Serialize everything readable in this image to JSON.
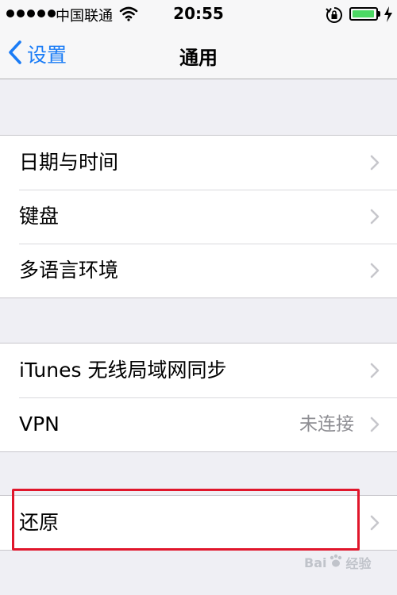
{
  "status_bar": {
    "carrier": "中国联通",
    "time": "20:55",
    "signal_icon": "signal-dots-icon",
    "wifi_icon": "wifi-icon",
    "lock_icon": "rotation-lock-icon",
    "battery_icon": "battery-icon",
    "battery_level": 0.95,
    "charging_icon": "charging-bolt-icon",
    "battery_color": "#4cd964"
  },
  "nav": {
    "back_label": "设置",
    "back_icon": "chevron-left-icon",
    "title": "通用",
    "accent_color": "#1a7cf6"
  },
  "groups": [
    {
      "rows": [
        {
          "label": "日期与时间",
          "detail": ""
        },
        {
          "label": "键盘",
          "detail": ""
        },
        {
          "label": "多语言环境",
          "detail": ""
        }
      ]
    },
    {
      "rows": [
        {
          "label": "iTunes 无线局域网同步",
          "detail": ""
        },
        {
          "label": "VPN",
          "detail": "未连接"
        }
      ]
    },
    {
      "rows": [
        {
          "label": "还原",
          "detail": ""
        }
      ]
    }
  ],
  "annotation": {
    "highlight_color": "#e0162b"
  },
  "watermark": {
    "text": "Bai",
    "text2": "经验"
  }
}
